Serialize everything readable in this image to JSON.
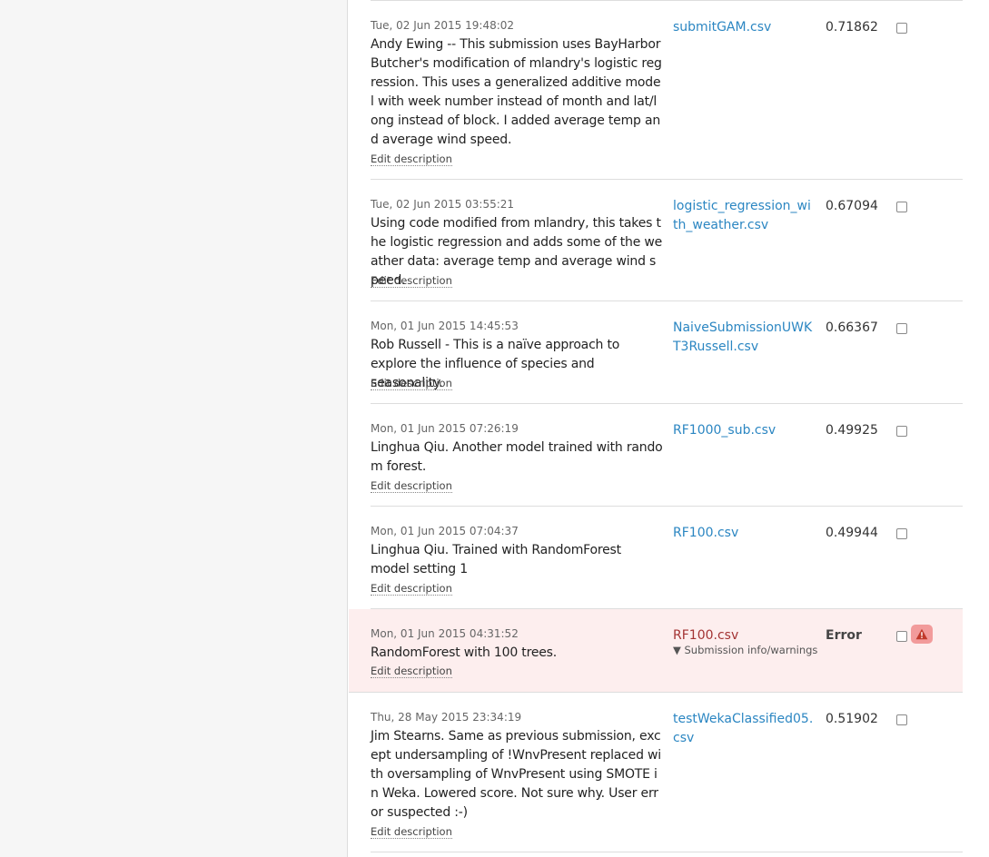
{
  "submissions": [
    {
      "date": "Tue, 02 Jun 2015 19:48:02",
      "description": "Andy Ewing -- This submission uses BayHarborButcher's modification of mlandry's logistic regression. This uses a generalized additive model with week number instead of month and lat/long instead of block. I added average temp and average wind speed.",
      "edit_label": "Edit description",
      "file": "submitGAM.csv",
      "score": "0.71862"
    },
    {
      "date": "Tue, 02 Jun 2015 03:55:21",
      "description": "Using code modified from mlandry, this takes the logistic regression and adds some of the weather data: average temp and average wind speed.",
      "edit_label": "Edit description",
      "file": "logistic_regression_with_weather.csv",
      "score": "0.67094"
    },
    {
      "date": "Mon, 01 Jun 2015 14:45:53",
      "description": "Rob Russell - This is a naïve approach to explore the influence of species and seasonality.",
      "edit_label": "Edit description",
      "file": "NaiveSubmissionUWKT3Russell.csv",
      "score": "0.66367"
    },
    {
      "date": "Mon, 01 Jun 2015 07:26:19",
      "description": "Linghua Qiu. Another model trained with random forest.",
      "edit_label": "Edit description",
      "file": "RF1000_sub.csv",
      "score": "0.49925"
    },
    {
      "date": "Mon, 01 Jun 2015 07:04:37",
      "description": "Linghua Qiu. Trained with RandomForest model setting 1",
      "edit_label": "Edit description",
      "file": "RF100.csv",
      "score": "0.49944"
    },
    {
      "date": "Mon, 01 Jun 2015 04:31:52",
      "description": "RandomForest with 100 trees.",
      "edit_label": "Edit description",
      "file": "RF100.csv",
      "info_label": "▼ Submission info/warnings",
      "score": "Error",
      "status": "error"
    },
    {
      "date": "Thu, 28 May 2015 23:34:19",
      "description": "Jim Stearns. Same as previous submission, except undersampling of !WnvPresent replaced with oversampling of WnvPresent using SMOTE in Weka. Lowered score. Not sure why. User error suspected :-)",
      "edit_label": "Edit description",
      "file": "testWekaClassified05.csv",
      "score": "0.51902"
    }
  ],
  "colors": {
    "link": "#2b86c2",
    "error_background": "#fdeeee",
    "error_link": "#a33333",
    "warning_badge": "#f29b9b",
    "warning_icon": "#c0392b"
  },
  "icons": {
    "checkbox": "select-checkbox-icon",
    "warning": "warning-triangle-icon"
  }
}
